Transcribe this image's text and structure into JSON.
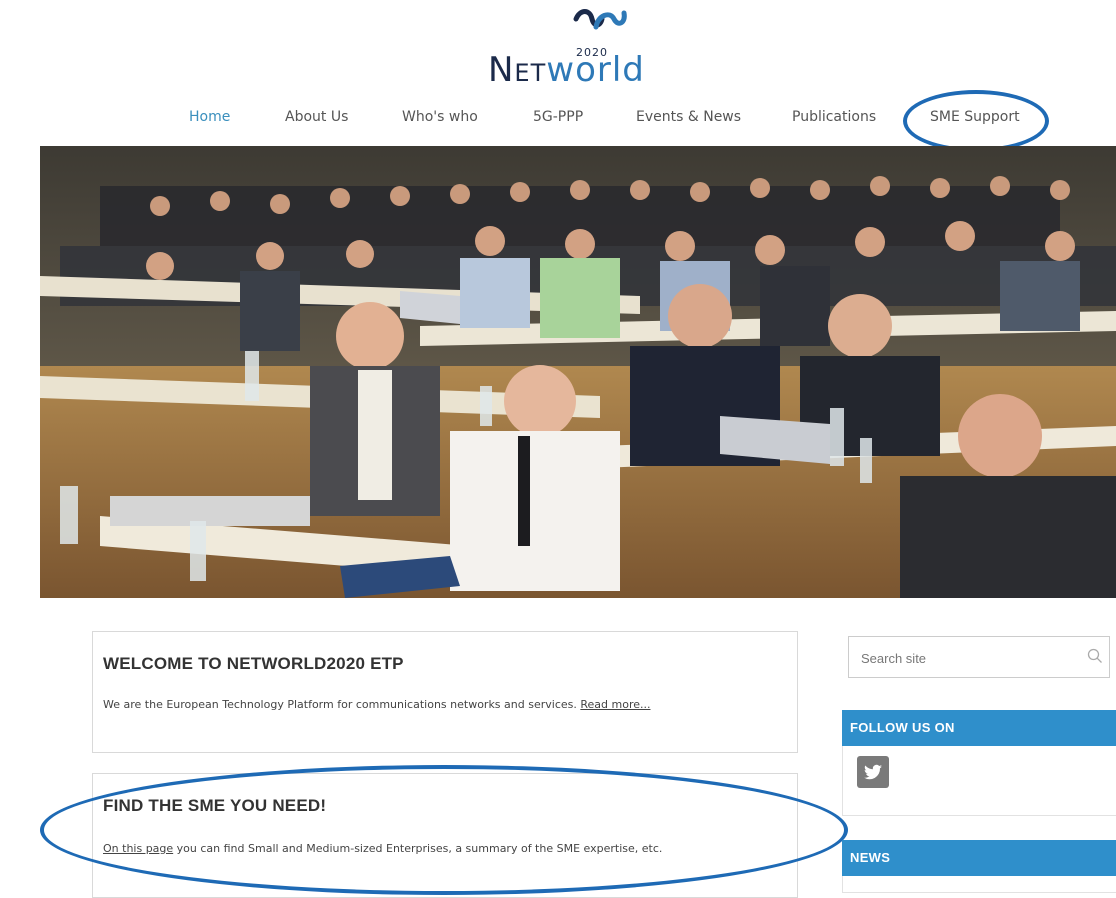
{
  "logo": {
    "year": "2020",
    "word_first": "Net",
    "word_second": "world",
    "colors": {
      "dark": "#1b2a4a",
      "blue": "#2e79b7"
    }
  },
  "nav": {
    "items": [
      "Home",
      "About Us",
      "Who's who",
      "5G-PPP",
      "Events & News",
      "Publications",
      "SME Support"
    ],
    "active": "Home"
  },
  "welcome": {
    "title": "WELCOME TO NETWORLD2020 ETP",
    "text": "We are the European Technology Platform for communications networks and services.",
    "link": "Read more..."
  },
  "sme": {
    "title": "FIND THE SME YOU NEED!",
    "link": "On this page",
    "text": " you can find Small and Medium-sized Enterprises, a summary of the SME expertise, etc."
  },
  "search": {
    "placeholder": "Search site"
  },
  "follow": {
    "title": "FOLLOW US ON",
    "icon": "twitter-icon"
  },
  "news": {
    "title": "NEWS"
  },
  "colors": {
    "accent": "#2f8fcb",
    "annotation": "#1e6ab5",
    "active_nav": "#3a8fbd"
  }
}
